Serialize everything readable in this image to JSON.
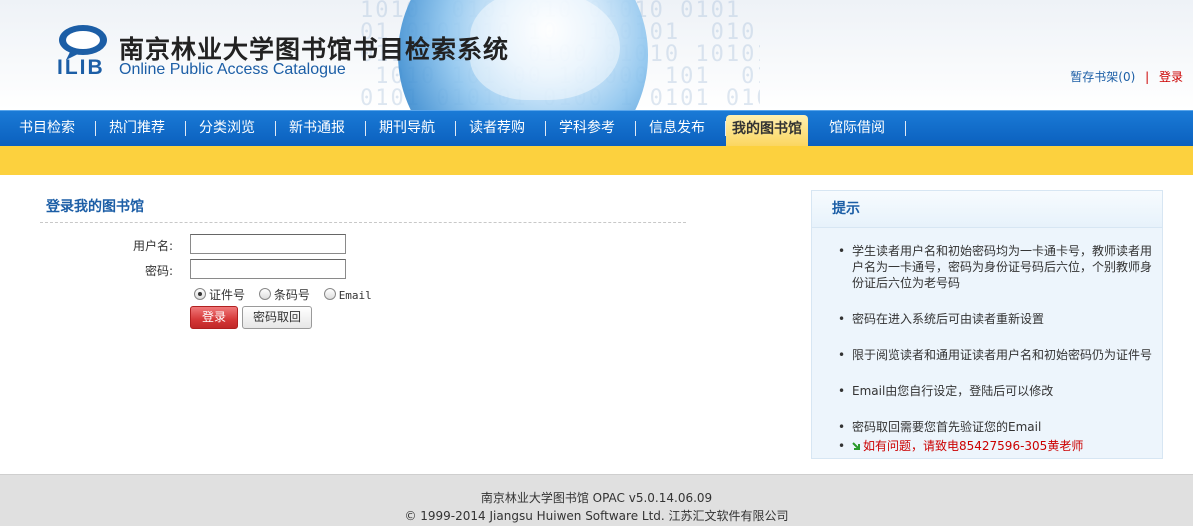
{
  "header": {
    "logo_text": "ILIB",
    "title": "南京林业大学图书馆书目检索系统",
    "subtitle": "Online Public Access Catalogue",
    "shelf_link": "暂存书架(0)",
    "separator": "|",
    "login_link": "登录"
  },
  "nav": {
    "items": [
      {
        "label": "书目检索"
      },
      {
        "label": "热门推荐"
      },
      {
        "label": "分类浏览"
      },
      {
        "label": "新书通报"
      },
      {
        "label": "期刊导航"
      },
      {
        "label": "读者荐购"
      },
      {
        "label": "学科参考"
      },
      {
        "label": "信息发布"
      },
      {
        "label": "我的图书馆"
      },
      {
        "label": "馆际借阅"
      }
    ],
    "active": "我的图书馆"
  },
  "login": {
    "title": "登录我的图书馆",
    "username_label": "用户名:",
    "username_value": "",
    "password_label": "密码:",
    "password_value": "",
    "radio_options": [
      "证件号",
      "条码号",
      "Email"
    ],
    "radio_selected": "证件号",
    "login_button": "登录",
    "retrieve_button": "密码取回"
  },
  "tips": {
    "title": "提示",
    "items": [
      "学生读者用户名和初始密码均为一卡通卡号，教师读者用户名为一卡通号，密码为身份证号码后六位，个别教师身份证后六位为老号码",
      "密码在进入系统后可由读者重新设置",
      "限于阅览读者和通用证读者用户名和初始密码仍为证件号",
      "Email由您自行设定，登陆后可以修改",
      "密码取回需要您首先验证您的Email",
      "如有问题，请致电85427596-305黄老师"
    ],
    "contact_color": "#cc0000"
  },
  "footer": {
    "line1": "南京林业大学图书馆   OPAC v5.0.14.06.09",
    "line2": "© 1999-2014 Jiangsu Huiwen Software Ltd. 江苏汇文软件有限公司"
  },
  "colors": {
    "nav_blue": "#0b60be",
    "accent_yellow": "#fcd13e",
    "link_blue": "#1c5ea6",
    "alert_red": "#cc0000"
  },
  "icons": {
    "logo": "chat-bubble-icon",
    "tip_arrow": "green-arrow-icon"
  }
}
